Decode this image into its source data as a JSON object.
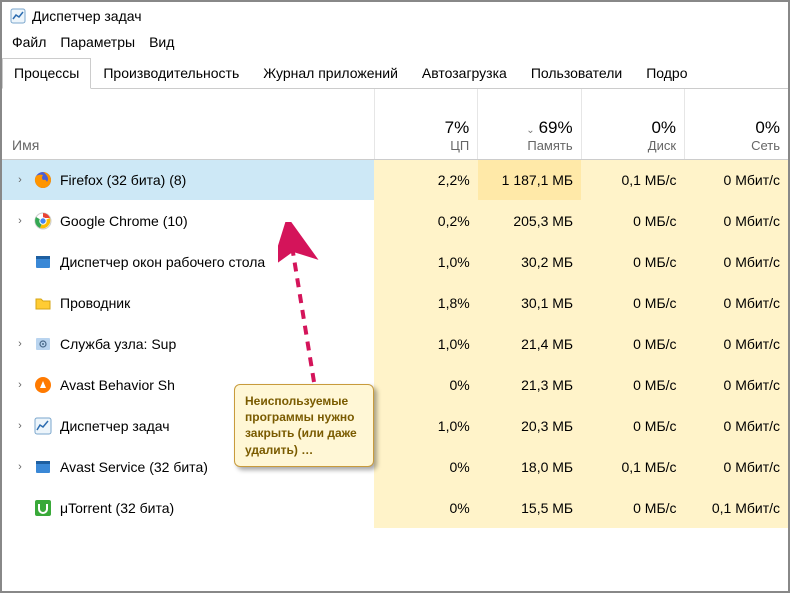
{
  "window": {
    "title": "Диспетчер задач"
  },
  "menu": {
    "file": "Файл",
    "options": "Параметры",
    "view": "Вид"
  },
  "tabs": {
    "processes": "Процессы",
    "performance": "Производительность",
    "apphistory": "Журнал приложений",
    "startup": "Автозагрузка",
    "users": "Пользователи",
    "details": "Подро"
  },
  "columns": {
    "name": "Имя",
    "cpu_pct": "7%",
    "cpu_label": "ЦП",
    "mem_pct": "69%",
    "mem_label": "Память",
    "disk_pct": "0%",
    "disk_label": "Диск",
    "net_pct": "0%",
    "net_label": "Сеть"
  },
  "rows": [
    {
      "name": "Firefox (32 бита) (8)",
      "cpu": "2,2%",
      "mem": "1 187,1 МБ",
      "disk": "0,1 МБ/с",
      "net": "0 Мбит/с",
      "icon": "firefox",
      "expandable": true,
      "selected": true
    },
    {
      "name": "Google Chrome (10)",
      "cpu": "0,2%",
      "mem": "205,3 МБ",
      "disk": "0 МБ/с",
      "net": "0 Мбит/с",
      "icon": "chrome",
      "expandable": true
    },
    {
      "name": "Диспетчер окон рабочего стола",
      "cpu": "1,0%",
      "mem": "30,2 МБ",
      "disk": "0 МБ/с",
      "net": "0 Мбит/с",
      "icon": "dwm",
      "expandable": false
    },
    {
      "name": "Проводник",
      "cpu": "1,8%",
      "mem": "30,1 МБ",
      "disk": "0 МБ/с",
      "net": "0 Мбит/с",
      "icon": "explorer",
      "expandable": false
    },
    {
      "name": "Служба узла: Sup",
      "cpu": "1,0%",
      "mem": "21,4 МБ",
      "disk": "0 МБ/с",
      "net": "0 Мбит/с",
      "icon": "svchost",
      "expandable": true
    },
    {
      "name": "Avast Behavior Sh",
      "cpu": "0%",
      "mem": "21,3 МБ",
      "disk": "0 МБ/с",
      "net": "0 Мбит/с",
      "icon": "avast",
      "expandable": true
    },
    {
      "name": "Диспетчер задач",
      "cpu": "1,0%",
      "mem": "20,3 МБ",
      "disk": "0 МБ/с",
      "net": "0 Мбит/с",
      "icon": "taskmgr",
      "expandable": true
    },
    {
      "name": "Avast Service (32 бита)",
      "cpu": "0%",
      "mem": "18,0 МБ",
      "disk": "0,1 МБ/с",
      "net": "0 Мбит/с",
      "icon": "avastsvc",
      "expandable": true
    },
    {
      "name": "μTorrent (32 бита)",
      "cpu": "0%",
      "mem": "15,5 МБ",
      "disk": "0 МБ/с",
      "net": "0,1 Мбит/с",
      "icon": "utorrent",
      "expandable": false
    }
  ],
  "annotation": {
    "text": "Неиспользуемые программы нужно закрыть (или даже удалить) …"
  },
  "icons": {
    "firefox": {
      "bg": "#fff",
      "svg": "firefox"
    },
    "chrome": {
      "bg": "#fff",
      "svg": "chrome"
    },
    "dwm": {
      "bg": "#3a88d6",
      "svg": "window"
    },
    "explorer": {
      "bg": "#ffcc33",
      "svg": "folder"
    },
    "svchost": {
      "bg": "#b9d4ef",
      "svg": "gear"
    },
    "avast": {
      "bg": "#ff7a00",
      "svg": "avast"
    },
    "taskmgr": {
      "bg": "#fff",
      "svg": "chart"
    },
    "avastsvc": {
      "bg": "#3a88d6",
      "svg": "window"
    },
    "utorrent": {
      "bg": "#39a939",
      "svg": "utorrent"
    }
  }
}
